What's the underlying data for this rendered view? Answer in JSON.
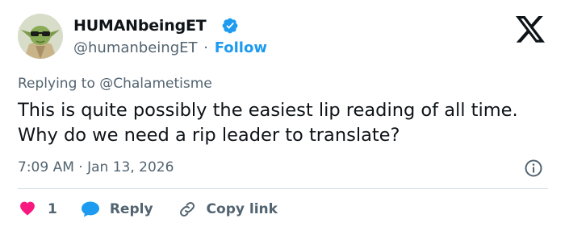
{
  "author": {
    "display_name": "HUMANbeingET",
    "handle": "@humanbeingET",
    "separator": "·",
    "follow_label": "Follow",
    "verified": true
  },
  "replying_to": {
    "prefix": "Replying to",
    "mention": "@Chalametisme"
  },
  "tweet": {
    "text": "This is quite possibly the easiest lip reading of all time. Why do we need a rip leader to translate?",
    "timestamp": "7:09 AM · Jan 13, 2026"
  },
  "actions": {
    "like_count": "1",
    "reply_label": "Reply",
    "copy_link_label": "Copy link"
  },
  "colors": {
    "accent": "#1d9bf0",
    "like": "#f91880",
    "text": "#0f1419",
    "muted": "#536471",
    "divider": "#cfd9de"
  },
  "icons": {
    "verified": "verified-badge-icon",
    "logo": "x-logo-icon",
    "info": "info-icon",
    "like": "heart-icon",
    "reply": "speech-bubble-icon",
    "copy": "link-icon"
  }
}
